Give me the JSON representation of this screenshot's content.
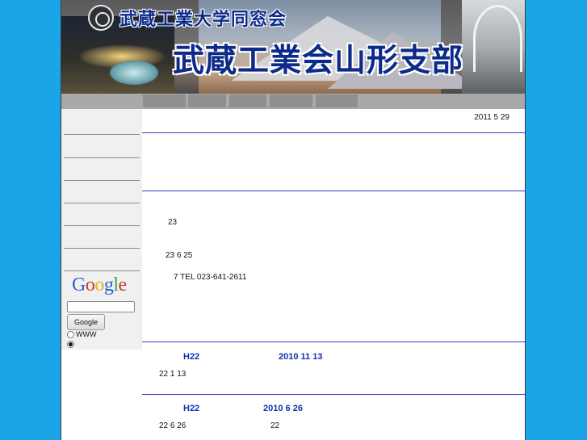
{
  "header": {
    "subtitle": "武蔵工業大学同窓会",
    "title": "武蔵工業会山形支部"
  },
  "date": "2011 5 29",
  "content": {
    "line1": "23",
    "line2": "23 6 25",
    "line3": "7  TEL 023-641-2611"
  },
  "news": [
    {
      "head_left": "H22",
      "head_right": "2010  11  13",
      "body_left": "22 1 13",
      "body_right": ""
    },
    {
      "head_left": "H22",
      "head_right": "2010  6  26",
      "body_left": "22 6 26",
      "body_right": "22"
    }
  ],
  "search": {
    "logo_text": "Google",
    "button_label": "Google",
    "option_www": "WWW",
    "selected_option": "site"
  },
  "colors": {
    "background": "#1aa6e6",
    "nav_bar": "#a9a9a9",
    "nav_tab": "#8f8f8f",
    "sidebar": "#f0f0f0",
    "rule": "#2b3fbf",
    "news_heading": "#1030b0"
  }
}
